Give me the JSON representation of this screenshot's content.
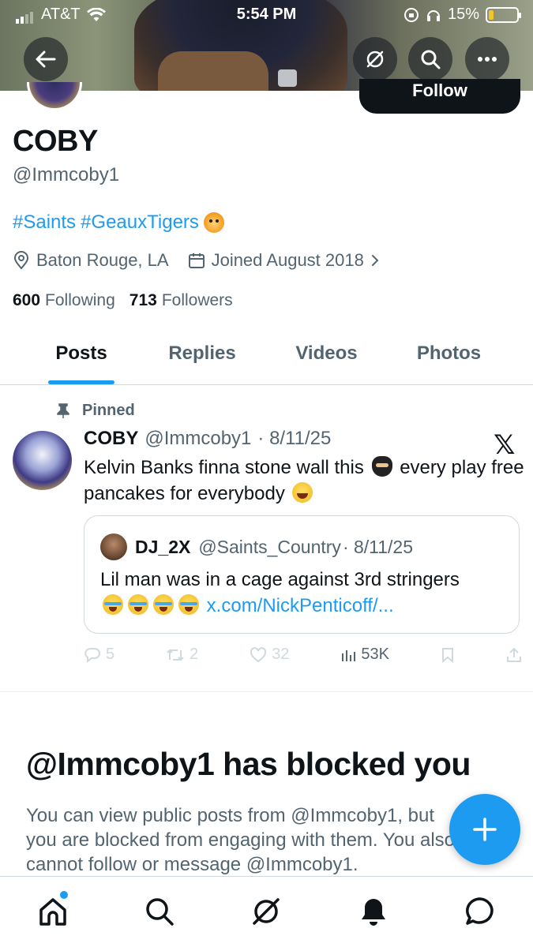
{
  "status_bar": {
    "carrier": "AT&T",
    "time": "5:54 PM",
    "battery": "15%"
  },
  "header": {
    "follow_button": "Follow"
  },
  "profile": {
    "name": "COBY",
    "handle": "@Immcoby1",
    "bio_hashtags": [
      "#Saints",
      "#GeauxTigers"
    ],
    "location": "Baton Rouge, LA",
    "joined": "Joined August 2018",
    "following_count": "600",
    "following_label": "Following",
    "followers_count": "713",
    "followers_label": "Followers"
  },
  "tabs": [
    {
      "label": "Posts",
      "active": true
    },
    {
      "label": "Replies",
      "active": false
    },
    {
      "label": "Videos",
      "active": false
    },
    {
      "label": "Photos",
      "active": false
    }
  ],
  "post": {
    "pinned_label": "Pinned",
    "author_name": "COBY",
    "author_handle": "@Immcoby1",
    "date": "· 8/11/25",
    "text_part1": "Kelvin Banks finna stone wall this",
    "text_part2": "every play free pancakes for everybody",
    "quote": {
      "author_name": "DJ_2X",
      "author_handle": "@Saints_Country",
      "date": "· 8/11/25",
      "text": "Lil man was in a cage against 3rd stringers",
      "link": "x.com/NickPenticoff/..."
    },
    "replies": "5",
    "reposts": "2",
    "likes": "32",
    "views": "53K"
  },
  "blocked": {
    "title": "@Immcoby1 has blocked you",
    "message": "You can view public posts from @Immcoby1, but you are blocked from engaging with them. You also cannot follow or message @Immcoby1."
  },
  "colors": {
    "accent": "#1d9bf0",
    "text": "#0f1419",
    "secondary": "#536471"
  }
}
